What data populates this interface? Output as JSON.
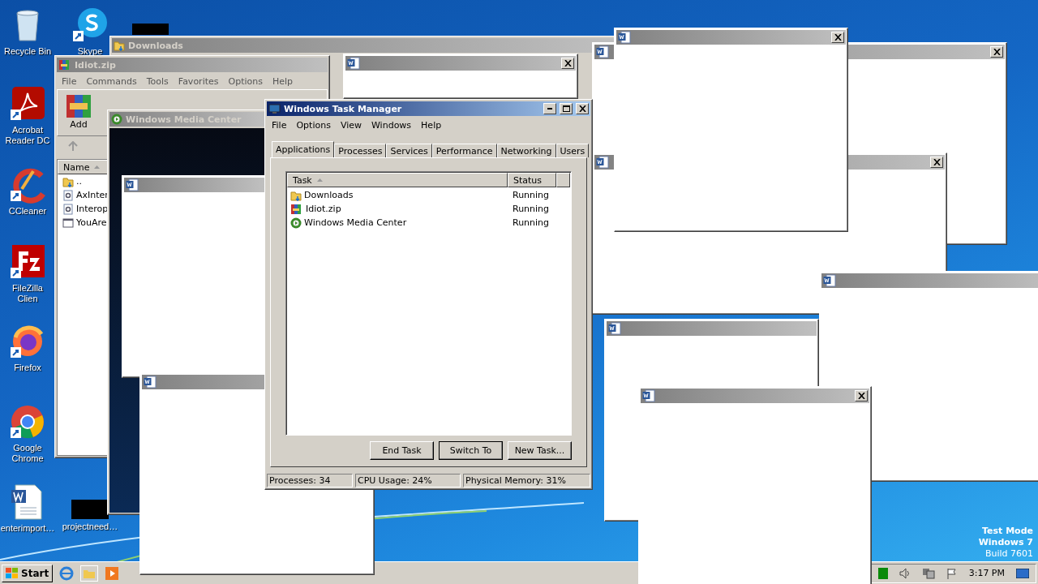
{
  "desktop_icons": [
    {
      "kind": "recycle",
      "label": "Recycle Bin"
    },
    {
      "kind": "skype",
      "label": "Skype"
    },
    {
      "kind": "acrobat",
      "label": "Acrobat Reader DC"
    },
    {
      "kind": "ccleaner",
      "label": "CCleaner"
    },
    {
      "kind": "filezilla",
      "label": "FileZilla Clien"
    },
    {
      "kind": "firefox",
      "label": "Firefox"
    },
    {
      "kind": "chrome",
      "label": "Google Chrome"
    },
    {
      "kind": "word",
      "label": "enterimport…"
    },
    {
      "kind": "redacted",
      "label": "projectneed…"
    }
  ],
  "os_notice": [
    "Test Mode",
    "Windows 7",
    "Build 7601"
  ],
  "downloads_window": {
    "title": "Downloads"
  },
  "archive_window": {
    "title": "Idiot.zip",
    "menu": [
      "File",
      "Commands",
      "Tools",
      "Favorites",
      "Options",
      "Help"
    ],
    "toolbar": [
      "Add"
    ],
    "column": "Name",
    "files": [
      {
        "kind": "folder",
        "name": ".."
      },
      {
        "kind": "dll",
        "name": "AxInter"
      },
      {
        "kind": "dll",
        "name": "Interop"
      },
      {
        "kind": "exe",
        "name": "YouAre"
      }
    ]
  },
  "media_center_window": {
    "title": "Windows Media Center"
  },
  "popups": [
    {
      "kind": "dialog",
      "close_button": true
    },
    {
      "kind": "dialog",
      "close_button": false
    },
    {
      "kind": "dialog",
      "close_button": false
    },
    {
      "kind": "dialog",
      "close_button": true
    },
    {
      "kind": "dialog",
      "close_button": true
    },
    {
      "kind": "dialog",
      "close_button": true
    },
    {
      "kind": "dialog",
      "close_button": false
    },
    {
      "kind": "dialog",
      "close_button": false
    },
    {
      "kind": "dialog",
      "close_button": true
    }
  ],
  "task_manager": {
    "title": "Windows Task Manager",
    "menu": [
      "File",
      "Options",
      "View",
      "Windows",
      "Help"
    ],
    "tabs": [
      {
        "label": "Applications",
        "selected": true
      },
      {
        "label": "Processes",
        "selected": false
      },
      {
        "label": "Services",
        "selected": false
      },
      {
        "label": "Performance",
        "selected": false
      },
      {
        "label": "Networking",
        "selected": false
      },
      {
        "label": "Users",
        "selected": false
      }
    ],
    "columns": [
      "Task",
      "Status"
    ],
    "rows": [
      {
        "kind": "folder",
        "task": "Downloads",
        "status": "Running"
      },
      {
        "kind": "archive",
        "task": "Idiot.zip",
        "status": "Running"
      },
      {
        "kind": "media",
        "task": "Windows Media Center",
        "status": "Running"
      }
    ],
    "buttons": [
      {
        "label": "End Task",
        "default": false
      },
      {
        "label": "Switch To",
        "default": true
      },
      {
        "label": "New Task...",
        "default": false
      }
    ],
    "status_bar": [
      "Processes: 34",
      "CPU Usage: 24%",
      "Physical Memory: 31%"
    ]
  },
  "taskbar": {
    "start": "Start",
    "clock": "3:17 PM"
  }
}
